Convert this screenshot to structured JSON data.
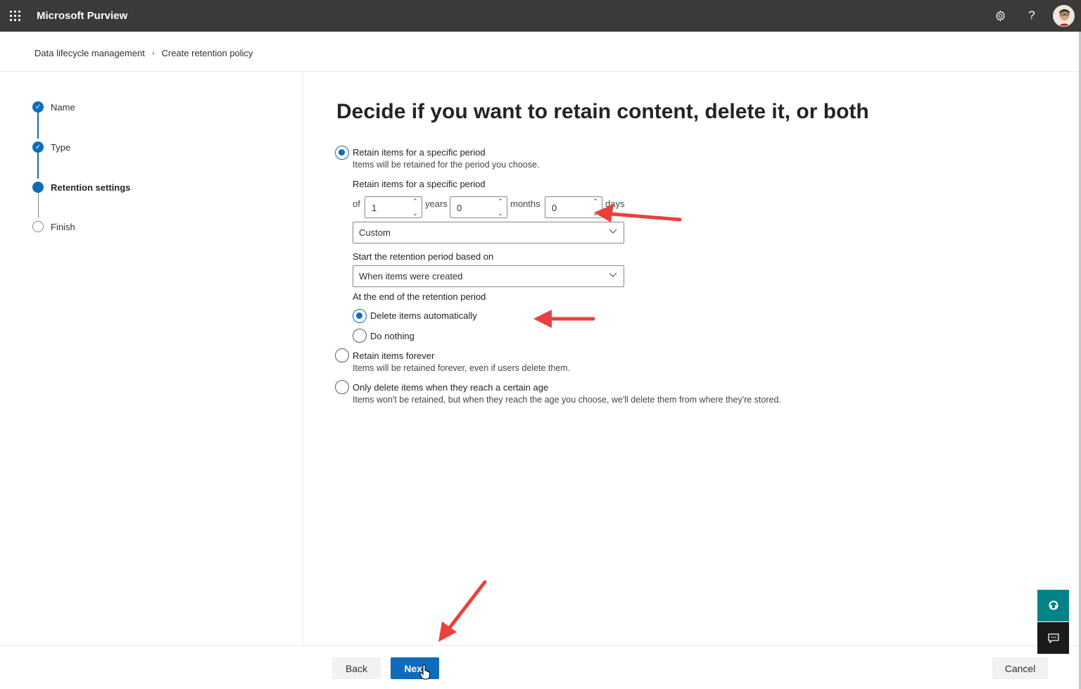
{
  "app": {
    "title": "Microsoft Purview"
  },
  "topbar": {
    "icons": [
      "waffle-icon",
      "gear-icon",
      "help-icon",
      "avatar"
    ],
    "help_glyph": "?"
  },
  "breadcrumb": {
    "items": [
      "Data lifecycle management",
      "Create retention policy"
    ]
  },
  "steps": [
    {
      "label": "Name",
      "state": "done"
    },
    {
      "label": "Type",
      "state": "done"
    },
    {
      "label": "Retention settings",
      "state": "current"
    },
    {
      "label": "Finish",
      "state": "todo"
    }
  ],
  "main": {
    "heading": "Decide if you want to retain content, delete it, or both",
    "option_retain_period": {
      "label": "Retain items for a specific period",
      "desc": "Items will be retained for the period you choose.",
      "selected": true
    },
    "period": {
      "label": "Retain items for a specific period",
      "prefix": "of",
      "years": "1",
      "years_unit": "years",
      "months": "0",
      "months_unit": "months",
      "days": "0",
      "days_unit": "days",
      "preset": "Custom"
    },
    "start_based_on": {
      "label": "Start the retention period based on",
      "value": "When items were created"
    },
    "end_of_period": {
      "label": "At the end of the retention period",
      "delete_label": "Delete items automatically",
      "nothing_label": "Do nothing",
      "selected": "delete"
    },
    "option_retain_forever": {
      "label": "Retain items forever",
      "desc": "Items will be retained forever, even if users delete them.",
      "selected": false
    },
    "option_delete_only": {
      "label": "Only delete items when they reach a certain age",
      "desc": "Items won't be retained, but when they reach the age you choose, we'll delete them from where they're stored.",
      "selected": false
    }
  },
  "footer": {
    "back": "Back",
    "next": "Next",
    "cancel": "Cancel"
  },
  "colors": {
    "accent": "#0f6cbd",
    "topbar": "#3b3a39",
    "annotation": "#e8413f",
    "teal": "#038387"
  }
}
